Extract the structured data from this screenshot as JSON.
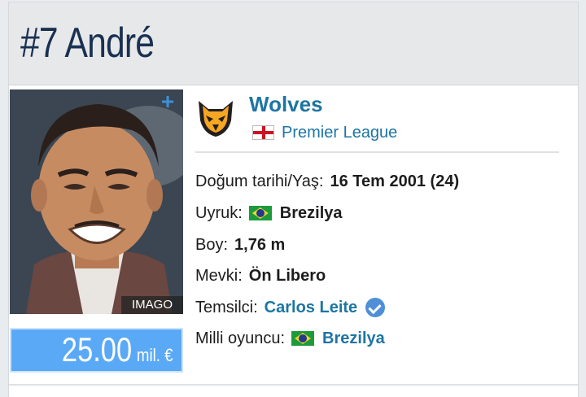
{
  "header": {
    "title": "#7 André"
  },
  "photo": {
    "credit": "IMAGO",
    "add_icon": "plus-icon"
  },
  "market_value": {
    "amount": "25.00",
    "unit": "mil. €"
  },
  "club": {
    "name": "Wolves",
    "league": "Premier League",
    "logo_icon": "wolf-head-icon"
  },
  "info": {
    "birth": {
      "label": "Doğum tarihi/Yaş:",
      "value": "16 Tem 2001 (24)"
    },
    "citizenship": {
      "label": "Uyruk:",
      "value": "Brezilya"
    },
    "height": {
      "label": "Boy:",
      "value": "1,76 m"
    },
    "position": {
      "label": "Mevki:",
      "value": "Ön Libero"
    },
    "agent": {
      "label": "Temsilci:",
      "value": "Carlos Leite"
    },
    "national": {
      "label": "Milli oyuncu:",
      "value": "Brezilya"
    }
  },
  "colors": {
    "header_text": "#1a3151",
    "link": "#1d75a3",
    "value_bg": "#5aa9f6",
    "wolves_gold": "#f5a623"
  }
}
